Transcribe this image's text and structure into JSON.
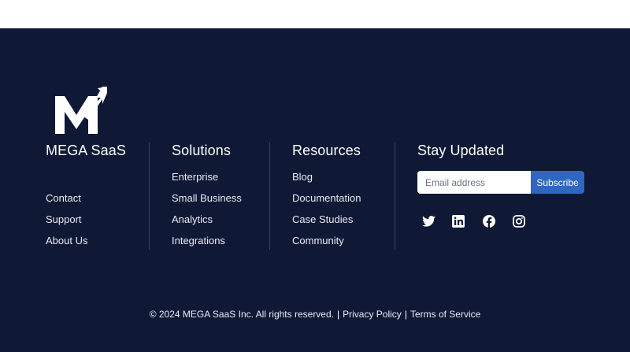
{
  "brand": {
    "name": "MEGA SaaS",
    "links": [
      "Contact",
      "Support",
      "About Us"
    ]
  },
  "solutions": {
    "title": "Solutions",
    "links": [
      "Enterprise",
      "Small Business",
      "Analytics",
      "Integrations"
    ]
  },
  "resources": {
    "title": "Resources",
    "links": [
      "Blog",
      "Documentation",
      "Case Studies",
      "Community"
    ]
  },
  "newsletter": {
    "title": "Stay Updated",
    "email_placeholder": "Email address",
    "subscribe_label": "Subscribe"
  },
  "social": [
    "twitter-icon",
    "linkedin-icon",
    "facebook-icon",
    "instagram-icon"
  ],
  "legal": {
    "copyright": "© 2024 MEGA SaaS Inc. All rights reserved.",
    "privacy": "Privacy Policy",
    "terms": "Terms of Service"
  },
  "colors": {
    "footer_bg": "#0f1835",
    "accent": "#2d67c2",
    "divider": "#3a4263"
  }
}
